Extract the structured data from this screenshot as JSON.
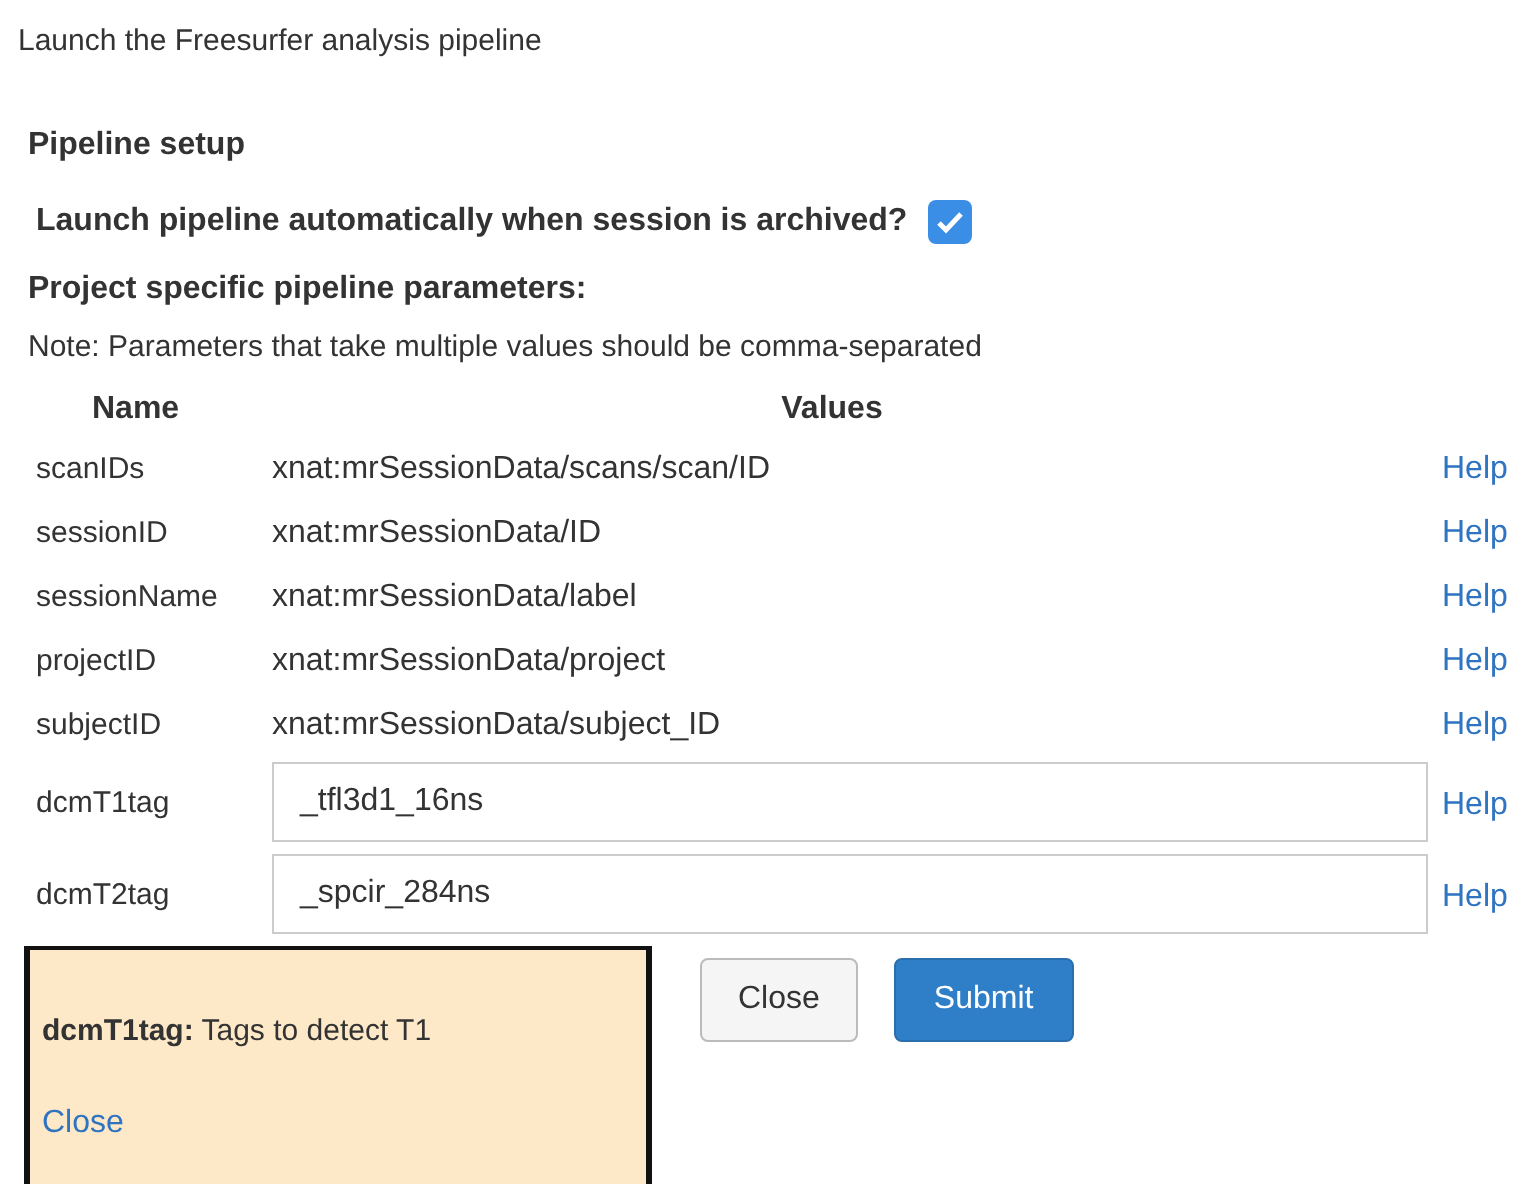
{
  "title": "Launch the Freesurfer analysis pipeline",
  "section_title": "Pipeline setup",
  "auto_launch": {
    "label": "Launch pipeline automatically when session is archived?",
    "checked": true
  },
  "params_title": "Project specific pipeline parameters:",
  "note": "Note: Parameters that take multiple values should be comma-separated",
  "table": {
    "columns": [
      "Name",
      "Values"
    ],
    "rows": [
      {
        "kind": "text",
        "name": "scanIDs",
        "value": "xnat:mrSessionData/scans/scan/ID",
        "help": "Help"
      },
      {
        "kind": "text",
        "name": "sessionID",
        "value": "xnat:mrSessionData/ID",
        "help": "Help"
      },
      {
        "kind": "text",
        "name": "sessionName",
        "value": "xnat:mrSessionData/label",
        "help": "Help"
      },
      {
        "kind": "text",
        "name": "projectID",
        "value": "xnat:mrSessionData/project",
        "help": "Help"
      },
      {
        "kind": "text",
        "name": "subjectID",
        "value": "xnat:mrSessionData/subject_ID",
        "help": "Help"
      },
      {
        "kind": "input",
        "name": "dcmT1tag",
        "value": "_tfl3d1_16ns",
        "help": "Help"
      },
      {
        "kind": "input",
        "name": "dcmT2tag",
        "value": "_spcir_284ns",
        "help": "Help"
      }
    ]
  },
  "help_popup": {
    "text": "**dcmT1tag:** Tags to detect T1",
    "close": "Close"
  },
  "buttons": [
    {
      "label": "Close",
      "kind": "secondary"
    },
    {
      "label": "Submit",
      "kind": "primary"
    }
  ]
}
